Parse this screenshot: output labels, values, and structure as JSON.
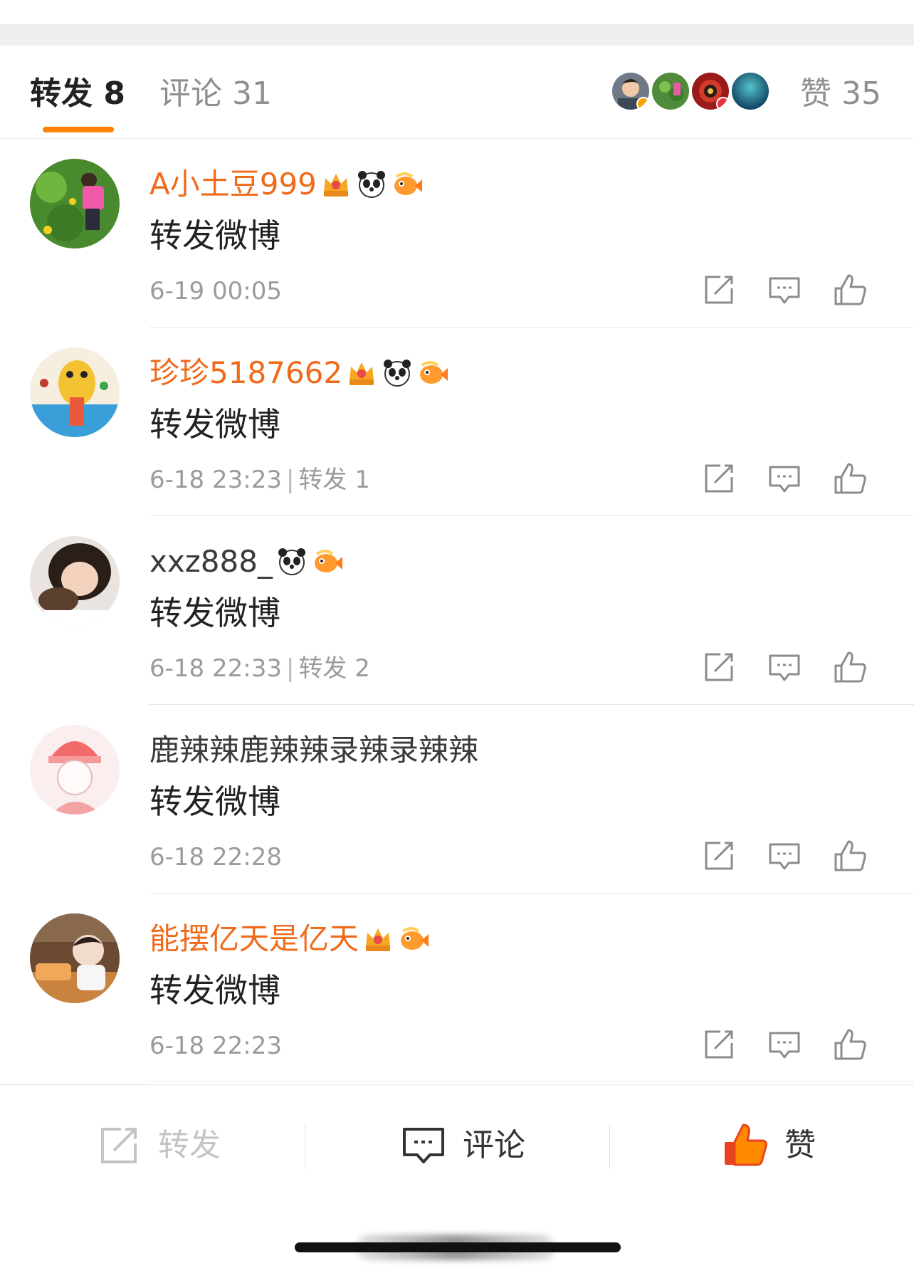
{
  "tabs": {
    "repost_label": "转发 8",
    "comment_label": "评论 31",
    "like_label": "赞 35"
  },
  "colors": {
    "accent": "#ff8200",
    "vip_name": "#f06a1a",
    "muted": "#9b9b9b"
  },
  "reposts": [
    {
      "username": "A小土豆999",
      "vip": true,
      "badges": [
        "crown-badge",
        "panda-badge",
        "fish-badge"
      ],
      "content": "转发微博",
      "time": "6-19 00:05",
      "repost_count_text": ""
    },
    {
      "username": "珍珍5187662",
      "vip": true,
      "badges": [
        "crown-badge",
        "panda-badge",
        "fish-badge"
      ],
      "content": "转发微博",
      "time": "6-18 23:23",
      "repost_count_text": "转发 1"
    },
    {
      "username": "xxz888_",
      "vip": false,
      "badges": [
        "panda-badge",
        "fish-badge"
      ],
      "content": "转发微博",
      "time": "6-18 22:33",
      "repost_count_text": "转发 2"
    },
    {
      "username": "鹿辣辣鹿辣辣录辣录辣辣",
      "vip": false,
      "badges": [],
      "content": "转发微博",
      "time": "6-18 22:28",
      "repost_count_text": ""
    },
    {
      "username": "能摆亿天是亿天",
      "vip": true,
      "badges": [
        "crown-badge",
        "fish-badge"
      ],
      "content": "转发微博",
      "time": "6-18 22:23",
      "repost_count_text": ""
    }
  ],
  "bottom_bar": {
    "repost_label": "转发",
    "comment_label": "评论",
    "like_label": "赞"
  }
}
